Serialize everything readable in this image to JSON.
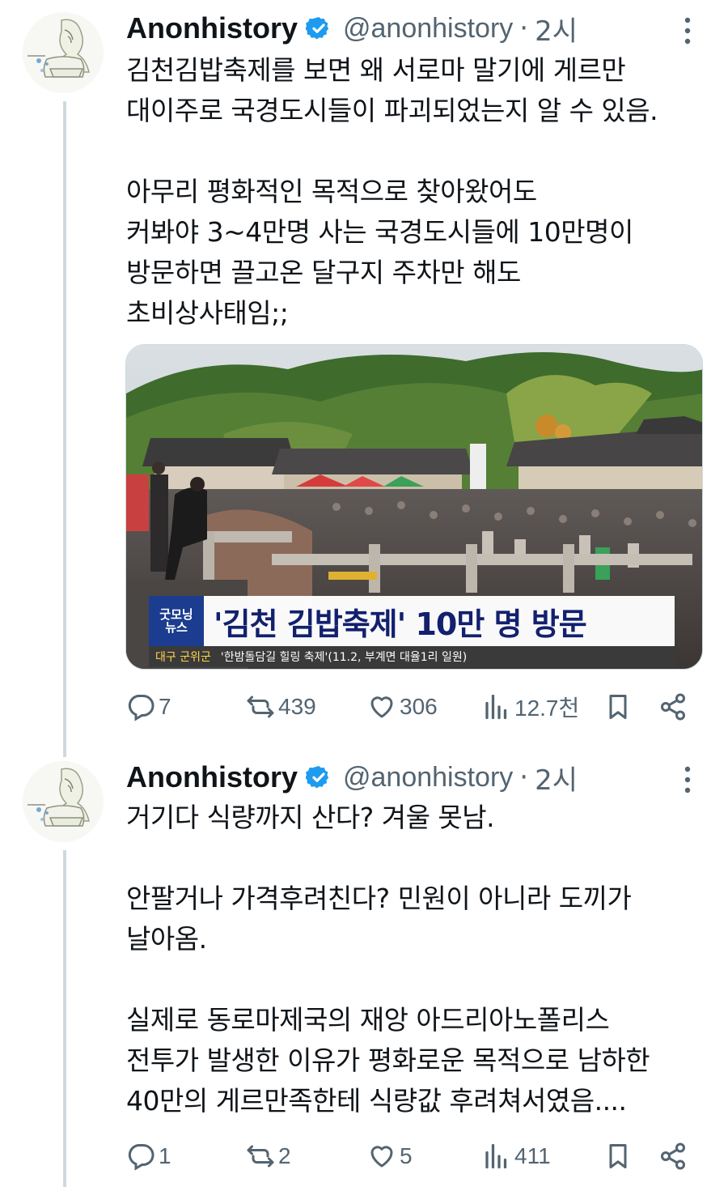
{
  "tweets": [
    {
      "author": {
        "name": "Anonhistory",
        "handle": "@anonhistory",
        "time": "2시",
        "separator": "·"
      },
      "text": "김천김밥축제를 보면 왜 서로마 말기에 게르만\n대이주로 국경도시들이 파괴되었는지 알 수 있음.\n\n아무리 평화적인 목적으로 찾아왔어도\n커봐야 3~4만명 사는 국경도시들에 10만명이\n방문하면 끌고온 달구지 주차만 해도\n초비상사태임;;",
      "media": {
        "caption_main": "'김천 김밥축제' 10만 명 방문",
        "caption_logo": "굿모닝\n뉴스",
        "caption_location": "대구 군위군",
        "caption_sub": "'한밤돌담길 힐링 축제'(11.2, 부계면 대율1리 일원)"
      },
      "stats": {
        "replies": "7",
        "reposts": "439",
        "likes": "306",
        "views": "12.7천"
      }
    },
    {
      "author": {
        "name": "Anonhistory",
        "handle": "@anonhistory",
        "time": "2시",
        "separator": "·"
      },
      "text": "거기다 식량까지 산다? 겨울 못남.\n\n안팔거나 가격후려친다? 민원이 아니라 도끼가\n날아옴.\n\n실제로 동로마제국의 재앙 아드리아노폴리스\n전투가 발생한 이유가 평화로운 목적으로 남하한\n40만의 게르만족한테 식량값 후려쳐서였음....",
      "stats": {
        "replies": "1",
        "reposts": "2",
        "likes": "5",
        "views": "411"
      }
    }
  ],
  "colors": {
    "verified": "#1d9bf0",
    "muted": "#536471",
    "text": "#0f1419",
    "thread_line": "#cfd9de"
  }
}
